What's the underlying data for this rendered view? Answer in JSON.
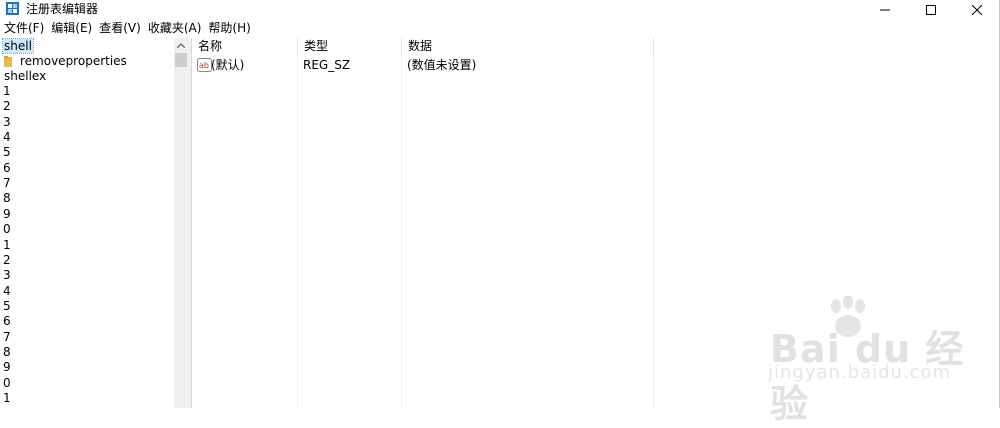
{
  "window": {
    "title": "注册表编辑器",
    "controls": {
      "minimize": "—",
      "maximize": "☐",
      "close": "✕"
    }
  },
  "menu": [
    "文件(F)",
    "编辑(E)",
    "查看(V)",
    "收藏夹(A)",
    "帮助(H)"
  ],
  "tree": {
    "selected": "shell",
    "child": "removeproperties",
    "sibling": "shellex",
    "items": [
      "1",
      "2",
      "3",
      "4",
      "5",
      "6",
      "7",
      "8",
      "9",
      "0",
      "1",
      "2",
      "3",
      "4",
      "5",
      "6",
      "7",
      "8",
      "9",
      "0",
      "1"
    ]
  },
  "values_pane": {
    "columns": [
      "名称",
      "类型",
      "数据"
    ],
    "rows": [
      {
        "name": "(默认)",
        "type": "REG_SZ",
        "data": "(数值未设置)",
        "icon": "string-value-icon"
      }
    ]
  },
  "watermark": {
    "brand": "Bai du 经验",
    "url": "jingyan.baidu.com"
  },
  "colors": {
    "selection": "#cce8ff",
    "scrollbar": "#f0f0f0",
    "thumb": "#cdcdcd",
    "folder": "#e8b94a"
  }
}
